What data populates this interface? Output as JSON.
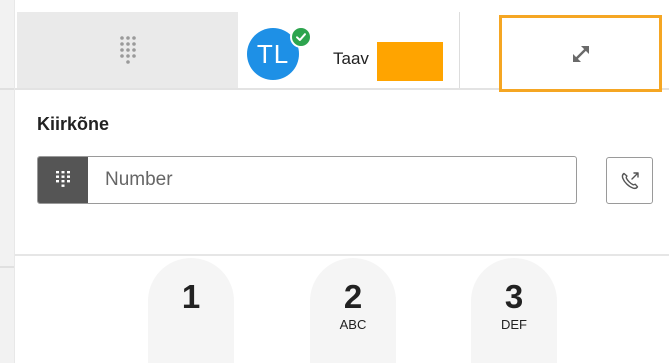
{
  "header": {
    "user": {
      "initials": "TL",
      "name_visible": "Taav",
      "presence": "available",
      "avatar_color": "#1e90e6",
      "presence_color": "#2da44e"
    },
    "tabs": [
      {
        "name": "dialpad",
        "icon": "dialpad-icon",
        "selected": true
      },
      {
        "name": "user"
      },
      {
        "name": "expand",
        "icon": "expand-icon",
        "highlight_color": "#f5a623"
      }
    ],
    "redaction_color": "#ffa400"
  },
  "panel": {
    "title": "Kiirkõne",
    "number_field": {
      "value": "",
      "placeholder": "Number",
      "icon": "dialpad-icon"
    },
    "call_button_icon": "phone-outgoing-icon"
  },
  "keypad": {
    "keys": [
      {
        "digit": "1",
        "letters": ""
      },
      {
        "digit": "2",
        "letters": "ABC"
      },
      {
        "digit": "3",
        "letters": "DEF"
      }
    ]
  }
}
